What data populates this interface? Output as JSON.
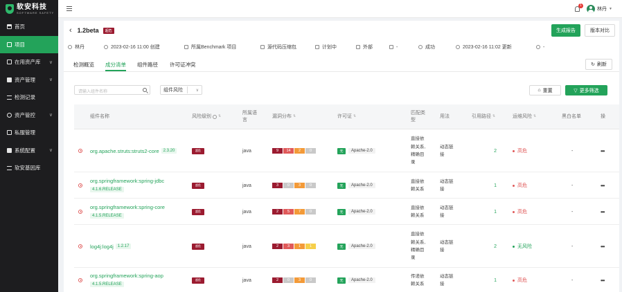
{
  "logo": {
    "main": "软安科技",
    "sub": "SOFTWARE SAFETY"
  },
  "sidebar": {
    "items": [
      {
        "label": "首页",
        "icon": "home-icon",
        "active": false,
        "arrow": ""
      },
      {
        "label": "项目",
        "icon": "project-icon",
        "active": true,
        "arrow": ""
      },
      {
        "label": "在用资产库",
        "icon": "asset-library-icon",
        "active": false,
        "arrow": "∨"
      },
      {
        "label": "资产管理",
        "icon": "asset-manage-icon",
        "active": false,
        "arrow": "∨"
      },
      {
        "label": "检测记录",
        "icon": "record-icon",
        "active": false,
        "arrow": ""
      },
      {
        "label": "资产管控",
        "icon": "control-icon",
        "active": false,
        "arrow": "∨"
      },
      {
        "label": "私服管理",
        "icon": "server-icon",
        "active": false,
        "arrow": ""
      },
      {
        "label": "系统配置",
        "icon": "settings-icon",
        "active": false,
        "arrow": "∨"
      },
      {
        "label": "软安基因库",
        "icon": "gene-library-icon",
        "active": false,
        "arrow": ""
      }
    ]
  },
  "topbar": {
    "bell_badge": "1",
    "user_name": "林丹"
  },
  "header": {
    "version": "1.2beta",
    "level_badge": "超危",
    "generate_report": "生成报告",
    "version_compare": "版本对比"
  },
  "meta": {
    "user": "林丹",
    "created": "2023-02-16 11:00 创建",
    "project": "所属Benchmark 项目",
    "source": "源代码压缩包",
    "plan": "计划中",
    "scope": "外部",
    "dash1": "-",
    "status": "成功",
    "updated": "2023-02-16 11:02 更新",
    "dash2": "-"
  },
  "tabs": [
    {
      "label": "检测概览",
      "active": false
    },
    {
      "label": "成分清单",
      "active": true
    },
    {
      "label": "组件路径",
      "active": false
    },
    {
      "label": "许可证冲突",
      "active": false
    }
  ],
  "refresh_label": "刷新",
  "filters": {
    "search_placeholder": "请输入组件名称",
    "risk_select": "组件风险",
    "reset": "重置",
    "more_filter": "更多筛选"
  },
  "table": {
    "columns": {
      "name": "组件名称",
      "level": "风险级别",
      "lang_1": "所属语",
      "lang_2": "言",
      "vuln": "漏洞分布",
      "license": "许可证",
      "match_1": "匹配类",
      "match_2": "型",
      "usage": "用法",
      "path": "引用路径",
      "ops_risk": "运维风险",
      "whitelist": "黑白名单",
      "action": "操"
    },
    "rows": [
      {
        "name": "org.apache.struts:struts2-core",
        "version": "2.3.20",
        "name_line2": "",
        "level_badge": "超危",
        "language": "java",
        "vulns": [
          {
            "v": "9",
            "c": "c"
          },
          {
            "v": "14",
            "c": "h"
          },
          {
            "v": "2",
            "c": "m"
          },
          {
            "v": "0",
            "c": "n"
          }
        ],
        "lic_badge": "无",
        "lic_name": "Apache-2.0",
        "match": [
          "直接依",
          "赖关系,",
          "精确目",
          "录"
        ],
        "usage": [
          "动态链",
          "接"
        ],
        "path": "2",
        "risk": "高危",
        "risk_color": "#e05a5a",
        "whitelist": "-",
        "action": "•••"
      },
      {
        "name": "org.springframework:spring-jdbc",
        "version": "4.1.6.RELEASE",
        "level_badge": "超危",
        "language": "java",
        "vulns": [
          {
            "v": "3",
            "c": "c"
          },
          {
            "v": "0",
            "c": "n"
          },
          {
            "v": "3",
            "c": "m"
          },
          {
            "v": "0",
            "c": "n"
          }
        ],
        "lic_badge": "无",
        "lic_name": "Apache-2.0",
        "match": [
          "直接依",
          "赖关系"
        ],
        "usage": [
          "动态链",
          "接"
        ],
        "path": "1",
        "risk": "高危",
        "risk_color": "#e05a5a",
        "whitelist": "-",
        "action": "•••"
      },
      {
        "name": "org.springframework:spring-core",
        "version": "4.1.5.RELEASE",
        "level_badge": "超危",
        "language": "java",
        "vulns": [
          {
            "v": "2",
            "c": "c"
          },
          {
            "v": "5",
            "c": "h"
          },
          {
            "v": "7",
            "c": "m"
          },
          {
            "v": "0",
            "c": "n"
          }
        ],
        "lic_badge": "无",
        "lic_name": "Apache-2.0",
        "match": [
          "直接依",
          "赖关系"
        ],
        "usage": [
          "动态链",
          "接"
        ],
        "path": "1",
        "risk": "高危",
        "risk_color": "#e05a5a",
        "whitelist": "-",
        "action": "•••"
      },
      {
        "name": "log4j:log4j",
        "version": "1.2.17",
        "level_badge": "超危",
        "language": "java",
        "vulns": [
          {
            "v": "2",
            "c": "c"
          },
          {
            "v": "3",
            "c": "h"
          },
          {
            "v": "1",
            "c": "m"
          },
          {
            "v": "1",
            "c": "l"
          }
        ],
        "lic_badge": "无",
        "lic_name": "Apache-2.0",
        "match": [
          "直接依",
          "赖关系,",
          "精确目",
          "录"
        ],
        "usage": [
          "动态链",
          "接"
        ],
        "path": "2",
        "risk": "无风险",
        "risk_color": "#23a35a",
        "whitelist": "-",
        "action": "•••"
      },
      {
        "name": "org.springframework:spring-aop",
        "version": "4.1.5.RELEASE",
        "level_badge": "超危",
        "language": "java",
        "vulns": [
          {
            "v": "2",
            "c": "c"
          },
          {
            "v": "0",
            "c": "n"
          },
          {
            "v": "3",
            "c": "m"
          },
          {
            "v": "0",
            "c": "n"
          }
        ],
        "lic_badge": "无",
        "lic_name": "Apache-2.0",
        "match": [
          "传递依",
          "赖关系"
        ],
        "usage": [
          "动态链",
          "接"
        ],
        "path": "1",
        "risk": "高危",
        "risk_color": "#e05a5a",
        "whitelist": "-",
        "action": "•••"
      }
    ]
  }
}
